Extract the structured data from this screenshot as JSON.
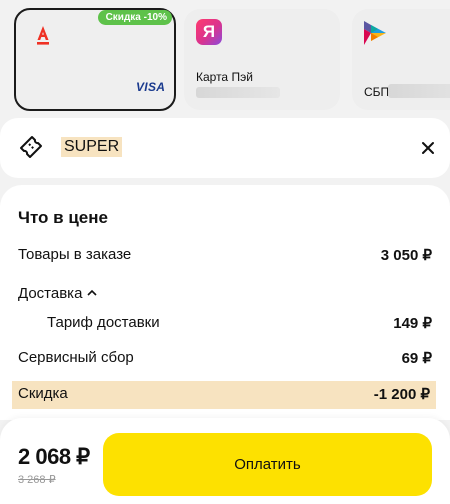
{
  "payment_methods": [
    {
      "badge": "Скидка -10%",
      "brand_icon": "alfa-bank-icon",
      "network": "VISA",
      "selected": true
    },
    {
      "brand_icon": "yandex-pay-icon",
      "brand_letter": "Я",
      "label": "Карта Пэй"
    },
    {
      "brand_icon": "sbp-icon",
      "label": "СБП ·"
    }
  ],
  "promo": {
    "icon": "coupon-icon",
    "code": "SUPER",
    "close_icon": "close-icon"
  },
  "price_breakdown": {
    "title": "Что в цене",
    "rows": [
      {
        "label": "Товары в заказе",
        "value": "3 050 ₽"
      },
      {
        "label": "Доставка",
        "value": ""
      },
      {
        "label": "Тариф доставки",
        "value": "149 ₽"
      },
      {
        "label": "Сервисный сбор",
        "value": "69 ₽"
      },
      {
        "label": "Скидка",
        "value": "-1 200 ₽"
      }
    ]
  },
  "footer": {
    "total": "2 068 ₽",
    "old_total": "3 268 ₽",
    "pay_label": "Оплатить"
  },
  "colors": {
    "accent": "#fde100",
    "highlight": "#f7e3c0",
    "badge": "#5ec24a",
    "alfa_red": "#ef3124"
  }
}
